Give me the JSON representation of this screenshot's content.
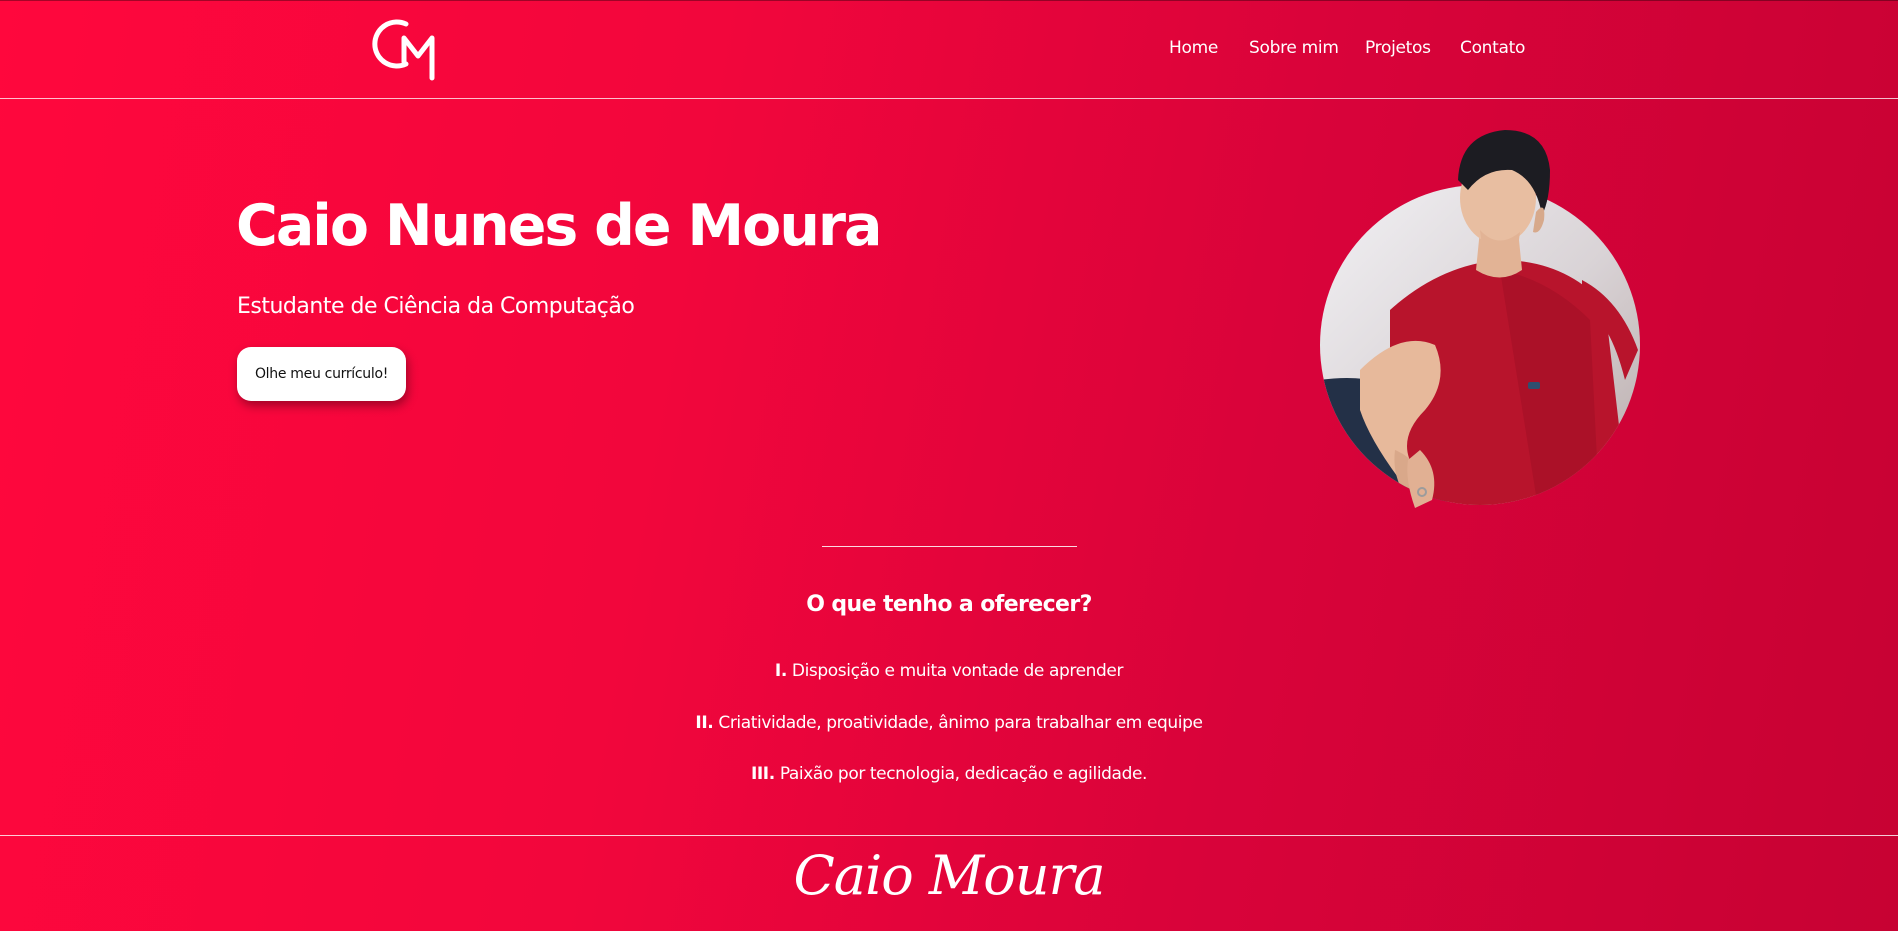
{
  "theme": {
    "accent": "#e8043a",
    "text_color": "#ffffff",
    "button_bg": "#ffffff",
    "button_text": "#111111"
  },
  "header": {
    "logo_icon": "cm-monogram-logo",
    "nav": [
      {
        "label": "Home"
      },
      {
        "label": "Sobre mim"
      },
      {
        "label": "Projetos"
      },
      {
        "label": "Contato"
      }
    ]
  },
  "hero": {
    "title": "Caio Nunes de Moura",
    "subtitle": "Estudante de Ciência da Computação",
    "cta_label": "Olhe meu currículo!",
    "photo_icon": "profile-photo"
  },
  "offer": {
    "title": "O que tenho a oferecer?",
    "items": [
      {
        "numeral": "I.",
        "text": "Disposição e muita vontade de aprender"
      },
      {
        "numeral": "II.",
        "text": "Criatividade, proatividade, ânimo para trabalhar em equipe"
      },
      {
        "numeral": "III.",
        "text": "Paixão por tecnologia, dedicação e agilidade."
      }
    ]
  },
  "footer": {
    "signature": "Caio Moura"
  }
}
